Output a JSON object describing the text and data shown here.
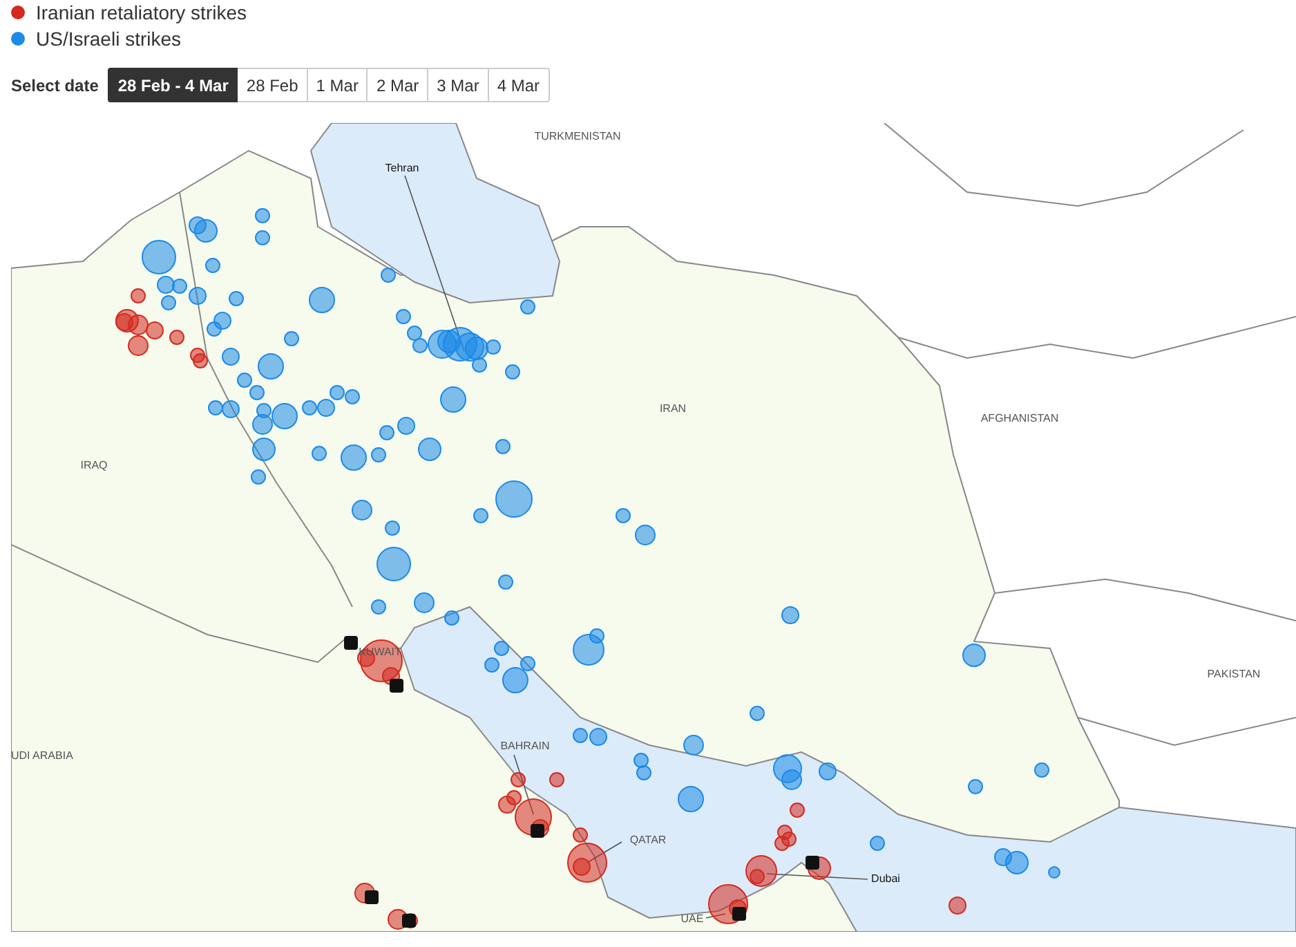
{
  "legend": [
    {
      "label": "Iranian retaliatory strikes",
      "color": "#d42a20"
    },
    {
      "label": "US/Israeli strikes",
      "color": "#1c8ae8"
    }
  ],
  "date_filter": {
    "label": "Select date",
    "options": [
      {
        "label": "28 Feb - 4 Mar",
        "selected": true
      },
      {
        "label": "28 Feb",
        "selected": false
      },
      {
        "label": "1 Mar",
        "selected": false
      },
      {
        "label": "2 Mar",
        "selected": false
      },
      {
        "label": "3 Mar",
        "selected": false
      },
      {
        "label": "4 Mar",
        "selected": false
      }
    ]
  },
  "map": {
    "country_labels": [
      "TURKMENISTAN",
      "IRAN",
      "AFGHANISTAN",
      "IRAQ",
      "PAKISTAN",
      "UDI ARABIA",
      "KUWAIT",
      "BAHRAIN",
      "QATAR",
      "UAE"
    ],
    "city_labels": [
      "Tehran",
      "Dubai"
    ]
  }
}
